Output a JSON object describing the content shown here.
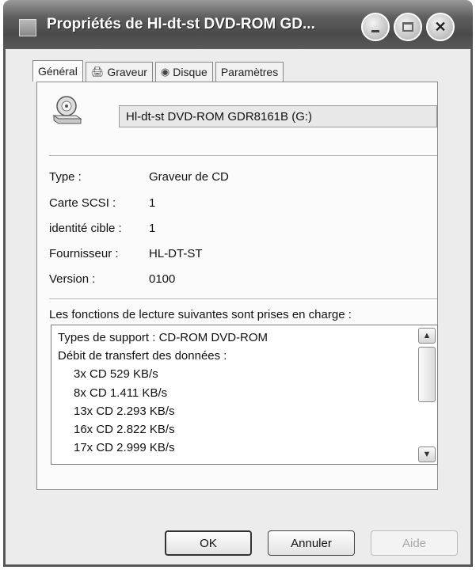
{
  "window": {
    "title": "Propriétés de Hl-dt-st DVD-ROM GD..."
  },
  "titlebar_buttons": {
    "minimize": "minimize-icon",
    "maximize": "maximize-icon",
    "close": "close-icon"
  },
  "tabs": [
    {
      "label": "Général",
      "icon": ""
    },
    {
      "label": "Graveur",
      "icon": "burner-icon"
    },
    {
      "label": "Disque",
      "icon": "disc-icon"
    },
    {
      "label": "Paramètres",
      "icon": ""
    }
  ],
  "device": {
    "name": "Hl-dt-st DVD-ROM GDR8161B (G:)",
    "icon": "cd-drive-icon"
  },
  "properties": [
    {
      "label": "Type :",
      "value": "Graveur de CD"
    },
    {
      "label": "Carte SCSI :",
      "value": "1"
    },
    {
      "label": "identité cible :",
      "value": "1"
    },
    {
      "label": "Fournisseur :",
      "value": "HL-DT-ST"
    },
    {
      "label": "Version :",
      "value": "0100"
    }
  ],
  "features": {
    "label": "Les fonctions de lecture suivantes sont prises en charge :",
    "lines": [
      "Types de support : CD-ROM DVD-ROM",
      "Débit de transfert des données :",
      "3x CD 529 KB/s",
      "8x CD 1.411 KB/s",
      "13x CD 2.293 KB/s",
      "16x CD 2.822 KB/s",
      "17x CD 2.999 KB/s"
    ]
  },
  "buttons": {
    "ok": "OK",
    "cancel": "Annuler",
    "help": "Aide"
  }
}
